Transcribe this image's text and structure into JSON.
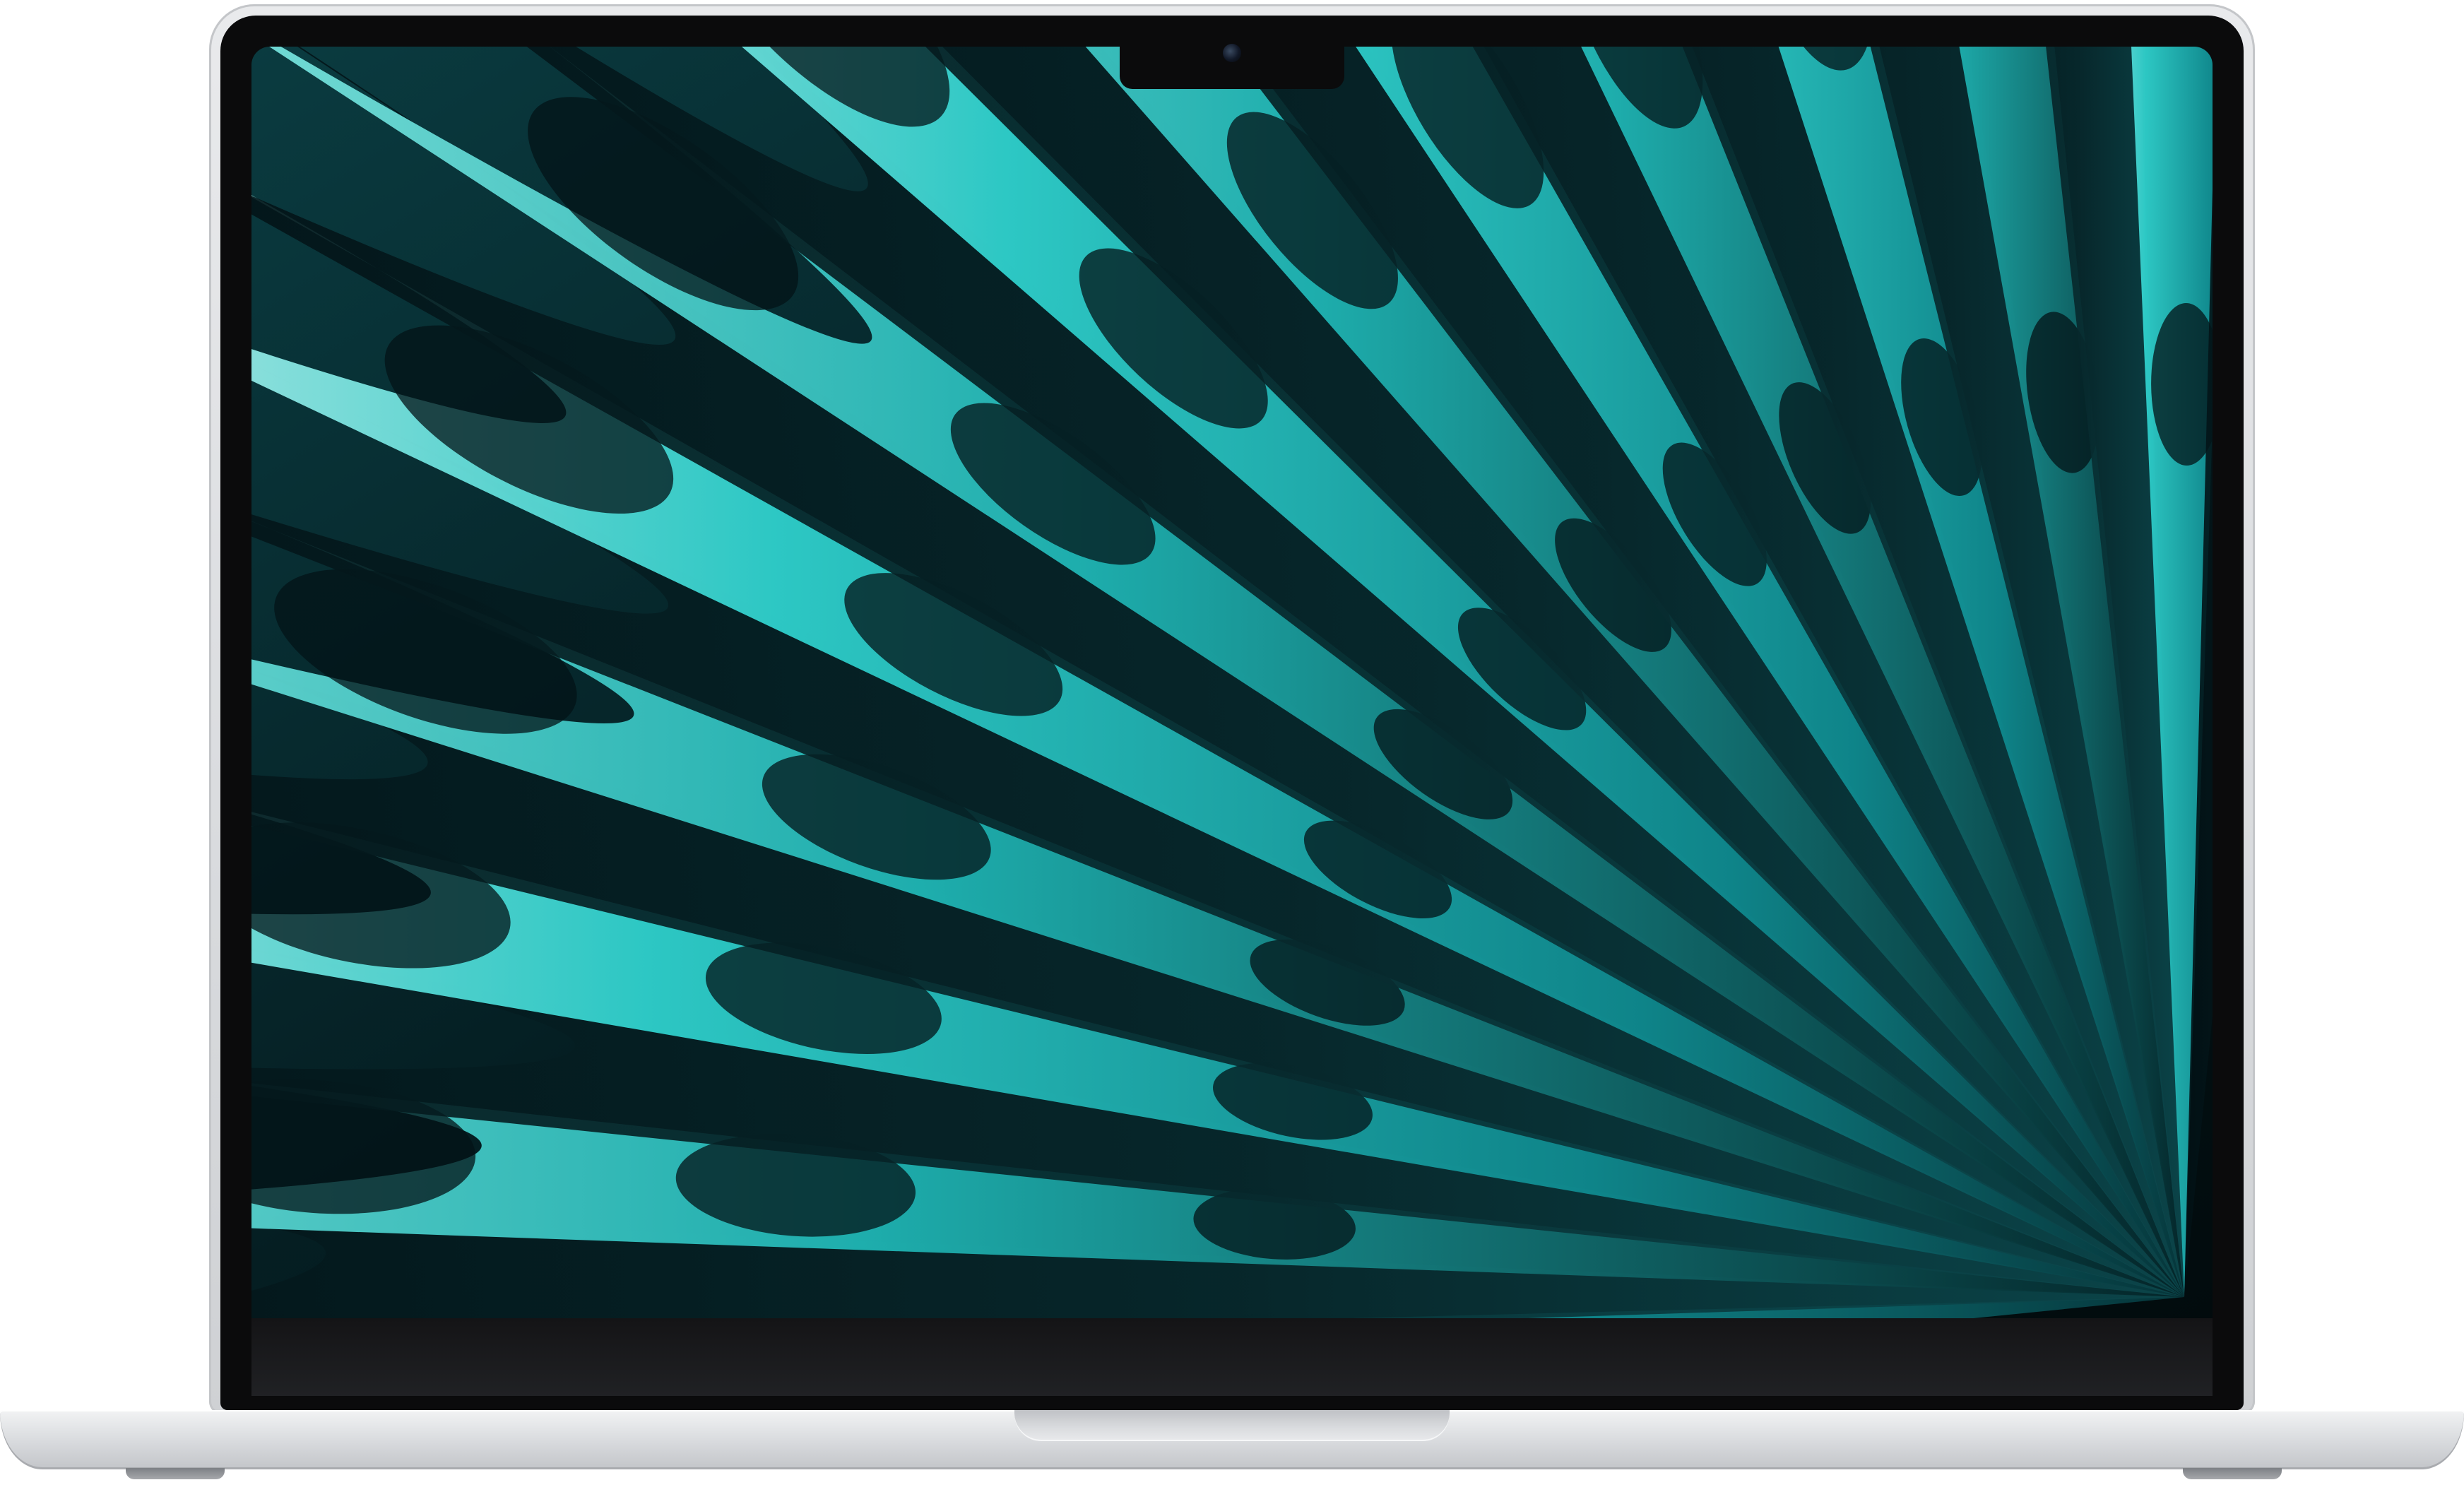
{
  "device": {
    "kind": "laptop",
    "finish_color": "#d9dbde",
    "bezel_color": "#0b0b0c"
  },
  "wallpaper": {
    "style": "radiating-fan-ribbons",
    "colors": {
      "deep": "#031317",
      "mid": "#0f8a8f",
      "bright": "#2fd0cc",
      "highlight": "#b9f2ee"
    }
  },
  "icons": {
    "camera": "camera-icon"
  }
}
